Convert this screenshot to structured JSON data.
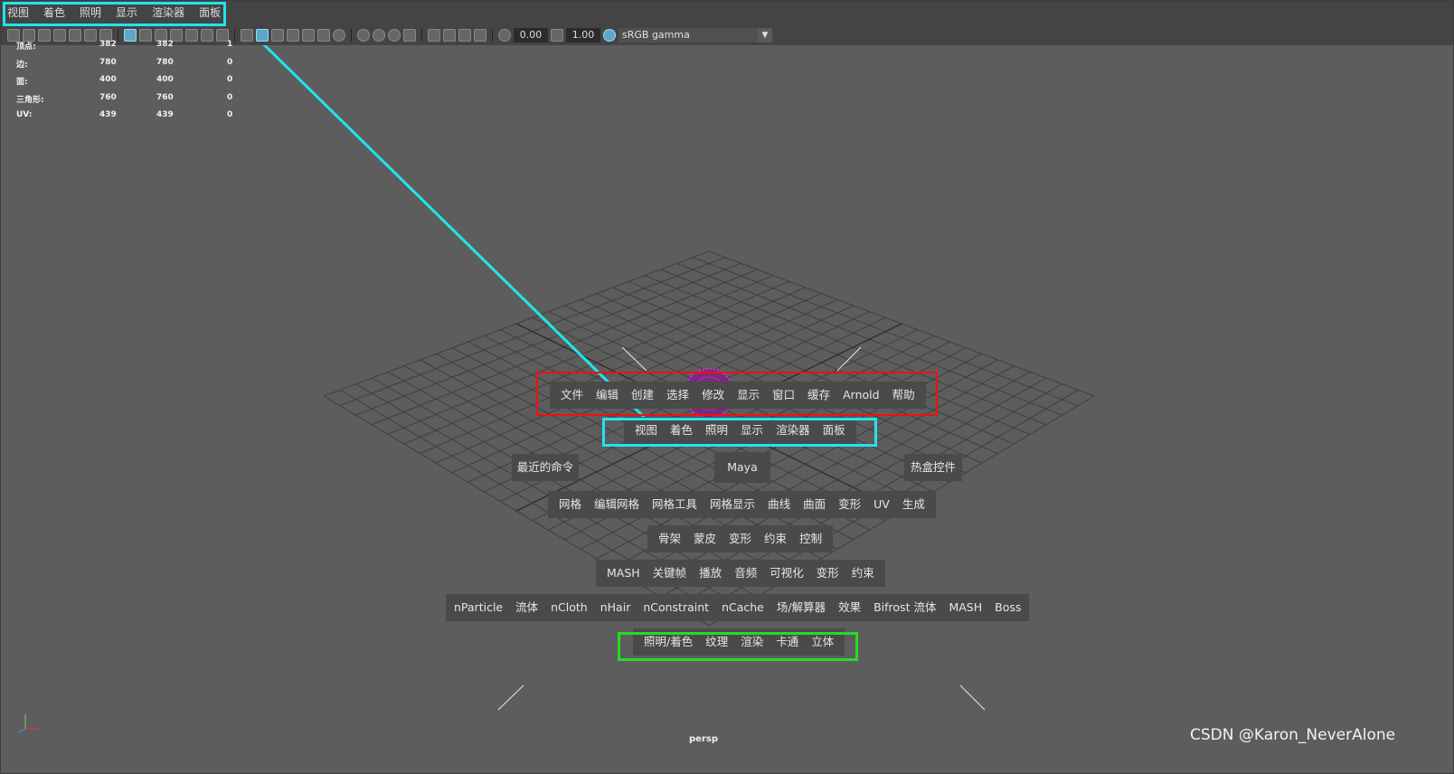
{
  "menubar": {
    "items": [
      "视图",
      "着色",
      "照明",
      "显示",
      "渲染器",
      "面板"
    ]
  },
  "toolbar": {
    "field_exposure": "0.00",
    "field_gamma": "1.00",
    "colorspace": "sRGB gamma"
  },
  "stats": {
    "rows": [
      {
        "label": "顶点:",
        "a": "382",
        "b": "382",
        "c": "1"
      },
      {
        "label": "边:",
        "a": "780",
        "b": "780",
        "c": "0"
      },
      {
        "label": "面:",
        "a": "400",
        "b": "400",
        "c": "0"
      },
      {
        "label": "三角形:",
        "a": "760",
        "b": "760",
        "c": "0"
      },
      {
        "label": "UV:",
        "a": "439",
        "b": "439",
        "c": "0"
      }
    ]
  },
  "hotbox": {
    "main_menu": [
      "文件",
      "编辑",
      "创建",
      "选择",
      "修改",
      "显示",
      "窗口",
      "缓存",
      "Arnold",
      "帮助"
    ],
    "panel_menu": [
      "视图",
      "着色",
      "照明",
      "显示",
      "渲染器",
      "面板"
    ],
    "recent": "最近的命令",
    "center": "Maya",
    "hotbox_controls": "热盒控件",
    "modeling": [
      "网格",
      "编辑网格",
      "网格工具",
      "网格显示",
      "曲线",
      "曲面",
      "变形",
      "UV",
      "生成"
    ],
    "rigging": [
      "骨架",
      "蒙皮",
      "变形",
      "约束",
      "控制"
    ],
    "animation": [
      "MASH",
      "关键帧",
      "播放",
      "音频",
      "可视化",
      "变形",
      "约束"
    ],
    "fx": [
      "nParticle",
      "流体",
      "nCloth",
      "nHair",
      "nConstraint",
      "nCache",
      "场/解算器",
      "效果",
      "Bifrost 流体",
      "MASH",
      "Boss"
    ],
    "rendering": [
      "照明/着色",
      "纹理",
      "渲染",
      "卡通",
      "立体"
    ]
  },
  "viewport": {
    "camera": "persp"
  },
  "watermark": "CSDN @Karon_NeverAlone",
  "colors": {
    "highlight_cyan": "#22e4ee",
    "highlight_red": "#ee1111",
    "highlight_green": "#22dd22",
    "viewport_bg": "#5d5d5d",
    "grid_line": "#3f3f3f",
    "sphere": "#cc22cc"
  }
}
